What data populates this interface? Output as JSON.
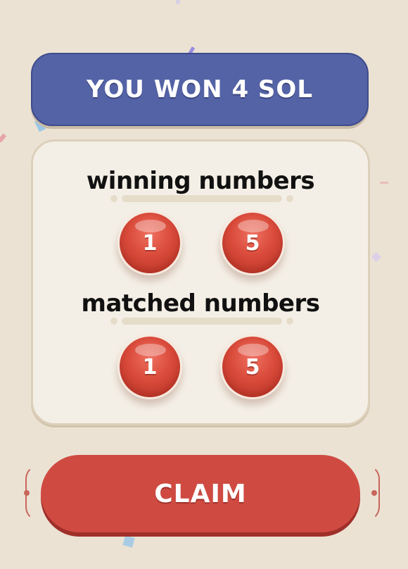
{
  "banner": {
    "text": "YOU WON 4 SOL"
  },
  "winning": {
    "heading": "winning numbers",
    "numbers": [
      "1",
      "5"
    ]
  },
  "matched": {
    "heading": "matched numbers",
    "numbers": [
      "1",
      "5"
    ]
  },
  "claim_button": {
    "label": "CLAIM"
  },
  "colors": {
    "background": "#ebe2d4",
    "banner": "#5463a6",
    "card": "#f4efe6",
    "ball": "#d94a3a",
    "claim": "#cf4a41"
  }
}
